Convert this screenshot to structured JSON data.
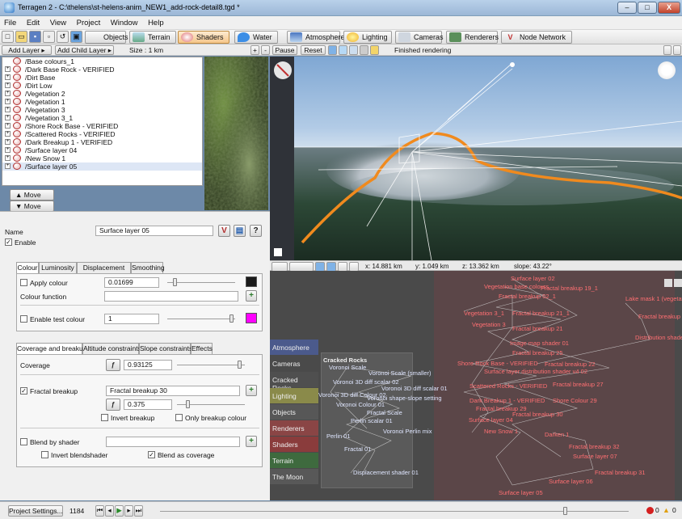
{
  "window": {
    "title": "Terragen 2 - C:\\thelens\\st-helens-anim_NEW1_add-rock-detail8.tgd *",
    "minimize": "–",
    "maximize": "□",
    "close": "X"
  },
  "menu": [
    "File",
    "Edit",
    "View",
    "Project",
    "Window",
    "Help"
  ],
  "toolbar": {
    "tabs": [
      "Objects",
      "Terrain",
      "Shaders",
      "Water",
      "Atmosphere",
      "Lighting",
      "Cameras",
      "Renderers",
      "Node Network"
    ],
    "active": "Shaders"
  },
  "subbar": {
    "add_layer": "Add Layer",
    "add_child_layer": "Add Child Layer",
    "size": "Size : 1 km",
    "pause": "Pause",
    "reset": "Reset",
    "render_status": "Finished rendering"
  },
  "layers": [
    {
      "label": "/Base colours_1",
      "expander": ""
    },
    {
      "label": "/Dark Base Rock - VERIFIED",
      "expander": "+"
    },
    {
      "label": "/Dirt Base",
      "expander": "+"
    },
    {
      "label": "/Dirt Low",
      "expander": "+"
    },
    {
      "label": "/Vegetation 2",
      "expander": "+"
    },
    {
      "label": "/Vegetation 1",
      "expander": "+"
    },
    {
      "label": "/Vegetation 3",
      "expander": "+"
    },
    {
      "label": "/Vegetation 3_1",
      "expander": "+"
    },
    {
      "label": "/Shore Rock Base - VERIFIED",
      "expander": "+"
    },
    {
      "label": "/Scattered Rocks - VERIFIED",
      "expander": "+"
    },
    {
      "label": "/Dark Breakup 1 - VERIFIED",
      "expander": "+"
    },
    {
      "label": "/Surface layer 04",
      "expander": "+"
    },
    {
      "label": "/New Snow 1",
      "expander": "+"
    },
    {
      "label": "/Surface layer 05",
      "expander": "+"
    }
  ],
  "move_up": "Move",
  "move_down": "Move",
  "props": {
    "name_label": "Name",
    "name_value": "Surface layer 05",
    "enable": "Enable",
    "tabs1": [
      "Colour",
      "Luminosity",
      "Displacement",
      "Smoothing"
    ],
    "apply_colour": "Apply colour",
    "apply_colour_value": "0.01699",
    "colour_function": "Colour function",
    "enable_test_colour": "Enable test colour",
    "test_colour_value": "1",
    "tabs2": [
      "Coverage and breakup",
      "Altitude constraints",
      "Slope constraints",
      "Effects"
    ],
    "coverage_label": "Coverage",
    "coverage_value": "0.93125",
    "fractal_breakup": "Fractal breakup",
    "fractal_breakup_value": "Fractal breakup 30",
    "breakup_amount": "0.375",
    "invert_breakup": "Invert breakup",
    "only_breakup_colour": "Only breakup colour",
    "blend_by_shader": "Blend by shader",
    "invert_blendshader": "Invert blendshader",
    "blend_as_coverage": "Blend as coverage",
    "colour_swatch": "#1a1a1a",
    "test_swatch": "#ff00ff"
  },
  "viewport": {
    "x": "x: 14.881 km",
    "y": "y: 1.049 km",
    "z": "z: 13.362 km",
    "slope": "slope: 43.22°"
  },
  "network": {
    "categories": [
      "Atmosphere",
      "Cameras",
      "Cracked Rocks",
      "Lighting",
      "Objects",
      "Renderers",
      "Shaders",
      "Terrain",
      "The Moon"
    ],
    "group_title": "Cracked Rocks",
    "grey_nodes": [
      "Voronoi Scale",
      "Voronoi Scale (smaller)",
      "Voronoi 3D diff scalar 02",
      "Voronoi 3D diff scalar 01",
      "Voronoi 3D diff Colour 02",
      "Voronoi shape-slope setting",
      "Voronoi Colour 01",
      "Fractal Scale",
      "Perlin scalar 01",
      "Voronoi Perlin mix",
      "Perlin 01",
      "Fractal 01",
      "Displacement shader 01"
    ],
    "red_nodes": [
      "Surface layer 02",
      "Vegetation base colours",
      "Fractal breakup 19_1",
      "Fractal breakup 02_1",
      "Vegetation 3_1",
      "Fractal breakup 21_1",
      "Vegetation 3",
      "Fractal breakup 21",
      "Image map shader 01",
      "Fractal breakup 25",
      "Shore Rock Base - VERIFIED",
      "Fractal breakup 22",
      "Surface layer distribution shader v4 02",
      "Scattered Rocks - VERIFIED",
      "Fractal breakup 27",
      "Dark Breakup 1 - VERIFIED",
      "Shore Colour 29",
      "Fractal breakup 29",
      "Surface layer 04",
      "Fractal breakup 30",
      "New Snow 1",
      "Darken 1",
      "Fractal breakup 32",
      "Surface layer 07",
      "Fractal breakup 31",
      "Surface layer 06",
      "Surface layer 05",
      "Lake mask 1 (vegetation)",
      "Distribution shader",
      "Fractal breakup 2"
    ]
  },
  "status": {
    "project_settings": "Project Settings...",
    "frame": "1184",
    "errors": "0",
    "warnings": "0"
  },
  "colors": {
    "accent_orange": "#f08a1e",
    "node_red": "#ff6f72",
    "selection": "#dde6f5"
  }
}
